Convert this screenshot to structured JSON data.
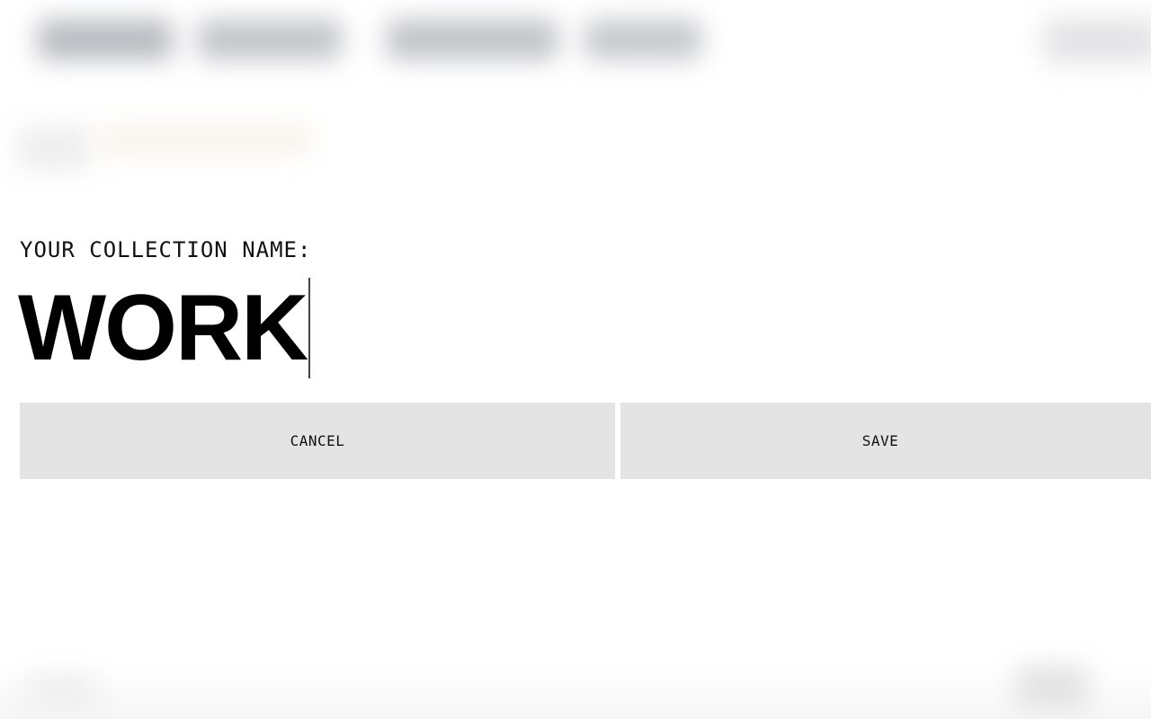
{
  "dialog": {
    "label": "YOUR COLLECTION NAME:",
    "input_value": "WORK",
    "cancel_label": "CANCEL",
    "save_label": "SAVE"
  }
}
